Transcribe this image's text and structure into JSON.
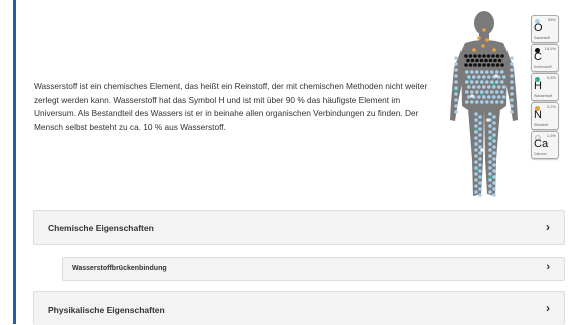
{
  "intro": {
    "text": "Wasserstoff ist ein chemisches Element, das heißt ein Reinstoff, der mit chemischen Methoden nicht weiter zerlegt werden kann. Wasserstoff hat das Symbol H und ist mit über 90 % das häufigste Element im Universum. Als Bestandteil des Wassers ist er in beinahe allen organischen Verbindungen zu finden. Der Mensch selbst besteht zu ca. 10 % aus Wasserstoff."
  },
  "elements": [
    {
      "symbol": "O",
      "percent": "65%",
      "name": "Sauerstoff",
      "color": "#a9cfe8"
    },
    {
      "symbol": "C",
      "percent": "18,5%",
      "name": "Kohlenstoff",
      "color": "#111111"
    },
    {
      "symbol": "H",
      "percent": "9,5%",
      "name": "Wasserstoff",
      "color": "#3aa89a"
    },
    {
      "symbol": "N",
      "percent": "3,2%",
      "name": "Stickstoff",
      "color": "#e8a23a"
    },
    {
      "symbol": "Ca",
      "percent": "1,5%",
      "name": "Calcium",
      "color": "#eeeeee"
    }
  ],
  "figure": {
    "body_color": "#7a7a7a"
  },
  "sections": [
    {
      "label": "Chemische Eigenschaften",
      "chevron": "›"
    },
    {
      "label": "Wasserstoffbrückenbindung",
      "chevron": "›"
    },
    {
      "label": "Physikalische Eigenschaften",
      "chevron": "›"
    }
  ]
}
